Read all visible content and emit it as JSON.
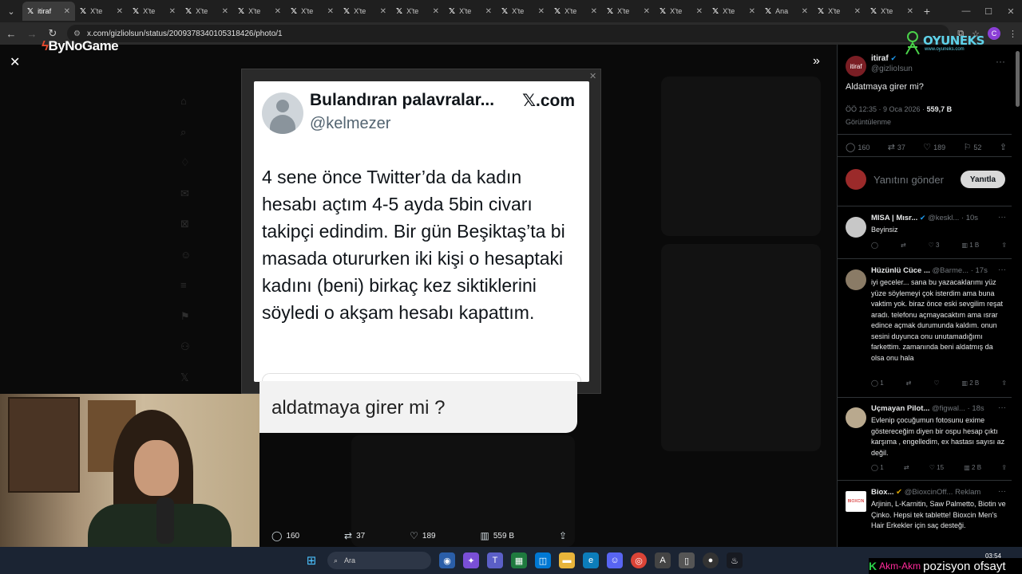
{
  "browser": {
    "tabs": [
      {
        "label": "itiraf",
        "active": true
      },
      {
        "label": "X'te"
      },
      {
        "label": "X'te"
      },
      {
        "label": "X'te"
      },
      {
        "label": "X'te"
      },
      {
        "label": "X'te"
      },
      {
        "label": "X'te"
      },
      {
        "label": "X'te"
      },
      {
        "label": "X'te"
      },
      {
        "label": "X'te"
      },
      {
        "label": "X'te"
      },
      {
        "label": "X'te"
      },
      {
        "label": "X'te"
      },
      {
        "label": "X'te"
      },
      {
        "label": "Ana"
      },
      {
        "label": "X'te"
      },
      {
        "label": "X'te"
      }
    ],
    "url": "x.com/gizliolsun/status/2009378340105318426/photo/1",
    "profile_initial": "C"
  },
  "overlay": {
    "brand": "ByNoGame",
    "oyuneks": "OYUNEKS",
    "oyuneks_sub": "www.oyuneks.com",
    "ticker_logo": "K",
    "ticker_pink": "Akm-Akm",
    "ticker_white": "pozisyon ofsayt"
  },
  "tweet_image": {
    "name": "Bulandıran palavralar...",
    "handle": "@kelmezer",
    "brand": "𝕏.com",
    "text": "4 sene önce Twitter’da da kadın hesabı açtım 4-5 ayda 5bin civarı takipçi edindim. Bir gün Beşiktaş’ta bi masada otururken iki kişi o hesaptaki kadını (beni) birkaç kez siktiklerini söyledi o akşam hesabı kapattım.",
    "caption": "aldatmaya girer mi ?"
  },
  "photo_actions": {
    "replies": "160",
    "reposts": "37",
    "likes": "189",
    "views": "559 B"
  },
  "sidebar": {
    "author_name": "itiraf",
    "author_handle": "@gizlioIsun",
    "question": "Aldatmaya girer mi?",
    "time": "ÖÖ 12:35 · 9 Oca 2026 ·",
    "views": "559,7 B",
    "views_label": "Görüntülenme",
    "stats": {
      "replies": "160",
      "reposts": "37",
      "likes": "189",
      "bookmarks": "52"
    },
    "reply_placeholder": "Yanıtını gönder",
    "reply_button": "Yanıtla",
    "replies": [
      {
        "name": "MISA | Mısr...",
        "handle": "@keskl... · 10s",
        "text": "Beyinsiz",
        "replies": "",
        "reposts": "",
        "likes": "3",
        "views": "1 B"
      },
      {
        "name": "Hüzünlü Cüce ...",
        "handle": "@Barme... · 17s",
        "text": "iyi geceler... sana bu yazacaklarımı yüz yüze söylemeyi çok isterdim ama buna vaktim yok. biraz önce eski sevgilim reşat aradı. telefonu açmayacaktım ama ısrar edince açmak durumunda kaldım. onun sesini duyunca onu unutamadığımı farkettim. zamanında beni aldatmış da olsa onu hala",
        "replies": "1",
        "reposts": "",
        "likes": "",
        "views": "2 B"
      },
      {
        "name": "Uçmayan Pilot...",
        "handle": "@figwal... · 18s",
        "text": "Evlenip çocuğumun fotosunu exime göstereceğim diyen bir ospu hesap çıktı karşıma , engelledim, ex hastası sayısı az değil.",
        "replies": "1",
        "reposts": "",
        "likes": "15",
        "views": "2 B"
      },
      {
        "name": "Biox...",
        "handle": "@BioxcinOff... Reklam",
        "text": "Arjinin, L-Karnitin, Saw Palmetto, Biotin ve Çinko. Hepsi tek tablette! Bioxcin Men's Hair Erkekler için saç desteği.",
        "replies": "",
        "reposts": "",
        "likes": "",
        "views": ""
      }
    ]
  },
  "taskbar": {
    "search_placeholder": "Ara",
    "time": "03:54",
    "date": ""
  },
  "colors": {
    "accent": "#1d9bf0",
    "background": "#000000",
    "card": "#ffffff"
  }
}
